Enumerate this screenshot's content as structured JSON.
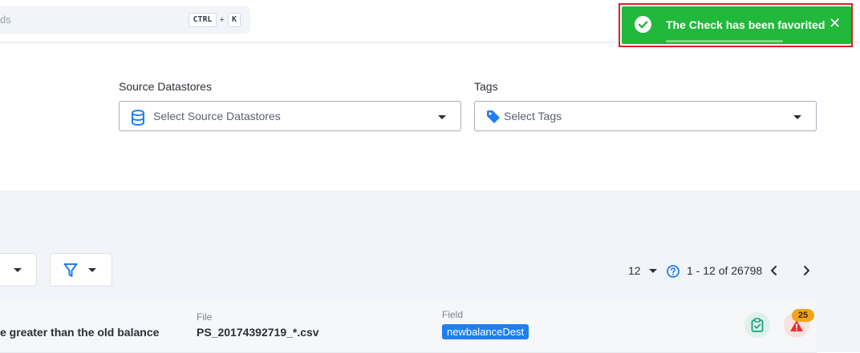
{
  "header": {
    "search_placeholder": "ds",
    "shortcut_ctrl": "CTRL",
    "shortcut_plus": "+",
    "shortcut_key": "K"
  },
  "toast": {
    "message": "The Check has been favorited",
    "close": "✕",
    "progress": 0.5
  },
  "filters": {
    "source_datastores": {
      "label": "Source Datastores",
      "placeholder": "Select Source Datastores"
    },
    "tags": {
      "label": "Tags",
      "placeholder": "Select Tags"
    }
  },
  "pagination": {
    "per_page": "12",
    "range": "1 - 12 of 26798",
    "help": "?"
  },
  "row": {
    "description": "e greater than the old balance",
    "file_label": "File",
    "file_value": "PS_20174392719_*.csv",
    "field_label": "Field",
    "field_value": "newbalanceDest",
    "anomaly_count": "25"
  },
  "colors": {
    "toast_green": "#22b83b",
    "toast_outline": "#e11d24",
    "chip_blue": "#1f7ff0",
    "badge_orange": "#f5a41a",
    "alert_red": "#e5322d"
  }
}
